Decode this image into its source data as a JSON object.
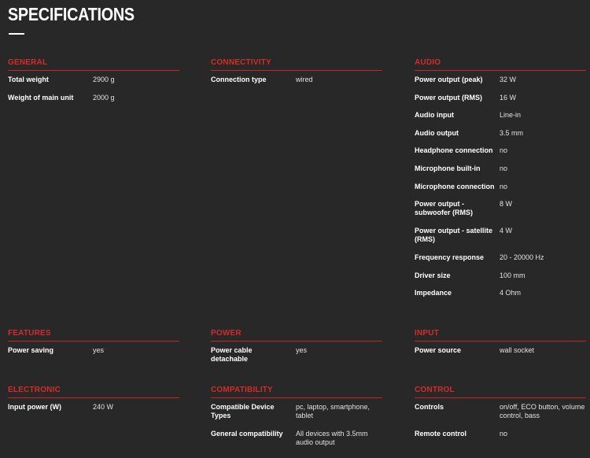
{
  "title": "SPECIFICATIONS",
  "sections": {
    "general": {
      "heading": "GENERAL",
      "rows": [
        {
          "label": "Total weight",
          "value": "2900 g"
        },
        {
          "label": "Weight of main unit",
          "value": "2000 g"
        }
      ]
    },
    "connectivity": {
      "heading": "CONNECTIVITY",
      "rows": [
        {
          "label": "Connection type",
          "value": "wired"
        }
      ]
    },
    "audio": {
      "heading": "AUDIO",
      "rows": [
        {
          "label": "Power output (peak)",
          "value": "32 W"
        },
        {
          "label": "Power output (RMS)",
          "value": "16 W"
        },
        {
          "label": "Audio input",
          "value": "Line-in"
        },
        {
          "label": "Audio output",
          "value": "3.5 mm"
        },
        {
          "label": "Headphone connection",
          "value": "no"
        },
        {
          "label": "Microphone built-in",
          "value": "no"
        },
        {
          "label": "Microphone connection",
          "value": "no"
        },
        {
          "label": "Power output - subwoofer (RMS)",
          "value": "8 W"
        },
        {
          "label": "Power output - satellite (RMS)",
          "value": "4 W"
        },
        {
          "label": "Frequency response",
          "value": "20 - 20000 Hz"
        },
        {
          "label": "Driver size",
          "value": "100 mm"
        },
        {
          "label": "Impedance",
          "value": "4 Ohm"
        }
      ]
    },
    "features": {
      "heading": "FEATURES",
      "rows": [
        {
          "label": "Power saving",
          "value": "yes"
        }
      ]
    },
    "power": {
      "heading": "POWER",
      "rows": [
        {
          "label": "Power cable detachable",
          "value": "yes"
        }
      ]
    },
    "input": {
      "heading": "INPUT",
      "rows": [
        {
          "label": "Power source",
          "value": "wall socket"
        }
      ]
    },
    "electronic": {
      "heading": "ELECTRONIC",
      "rows": [
        {
          "label": "Input power (W)",
          "value": "240 W"
        }
      ]
    },
    "compatibility": {
      "heading": "COMPATIBILITY",
      "rows": [
        {
          "label": "Compatible Device Types",
          "value": "pc, laptop, smartphone, tablet"
        },
        {
          "label": "General compatibility",
          "value": "All devices with 3.5mm audio output"
        }
      ]
    },
    "control": {
      "heading": "CONTROL",
      "rows": [
        {
          "label": "Controls",
          "value": "on/off, ECO button, volume control, bass"
        },
        {
          "label": "Remote control",
          "value": "no"
        }
      ]
    }
  },
  "colors": {
    "background": "#282828",
    "accent": "#d42b2b",
    "text": "#ffffff"
  }
}
